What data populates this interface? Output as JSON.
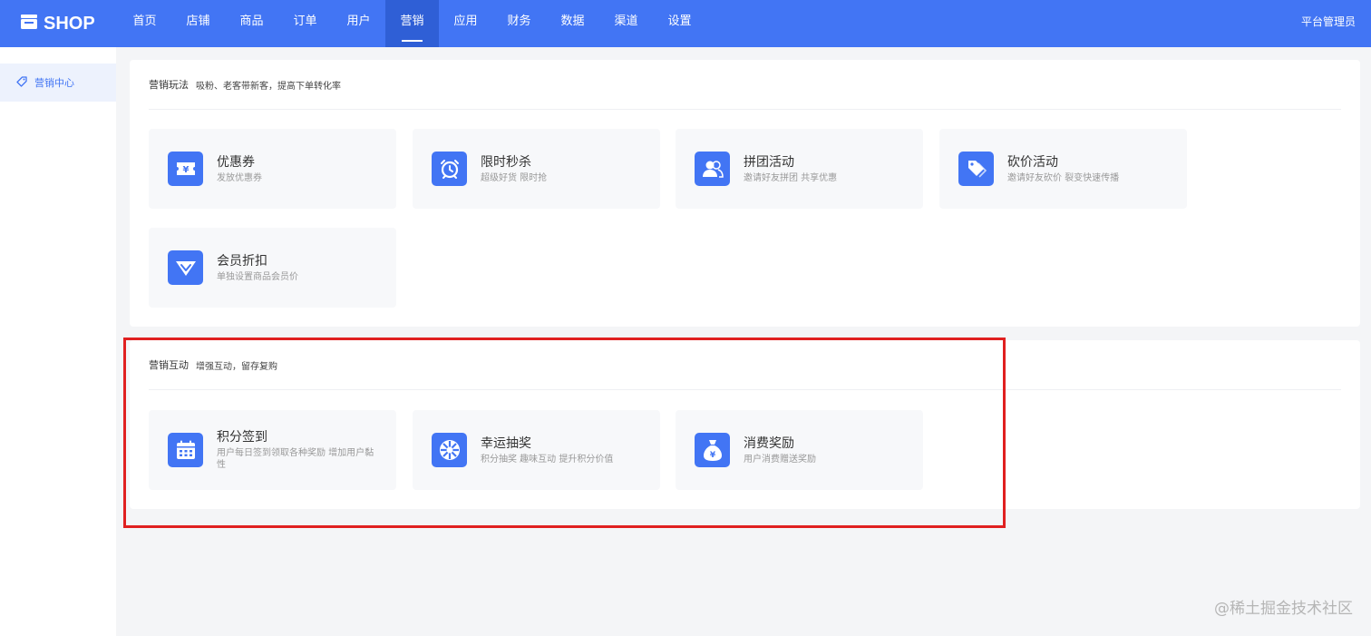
{
  "header": {
    "logo_text": "SHOP",
    "nav": [
      {
        "label": "首页",
        "active": false
      },
      {
        "label": "店铺",
        "active": false
      },
      {
        "label": "商品",
        "active": false
      },
      {
        "label": "订单",
        "active": false
      },
      {
        "label": "用户",
        "active": false
      },
      {
        "label": "营销",
        "active": true
      },
      {
        "label": "应用",
        "active": false
      },
      {
        "label": "财务",
        "active": false
      },
      {
        "label": "数据",
        "active": false
      },
      {
        "label": "渠道",
        "active": false
      },
      {
        "label": "设置",
        "active": false
      }
    ],
    "user_label": "平台管理员"
  },
  "sidebar": {
    "items": [
      {
        "label": "营销中心",
        "icon": "tag-icon",
        "active": true
      }
    ]
  },
  "sections": [
    {
      "title": "营销玩法",
      "subtitle": "吸粉、老客带新客，提高下单转化率",
      "cards": [
        {
          "title": "优惠券",
          "desc": "发放优惠券",
          "icon": "coupon-icon"
        },
        {
          "title": "限时秒杀",
          "desc": "超级好货 限时抢",
          "icon": "alarm-clock-icon"
        },
        {
          "title": "拼团活动",
          "desc": "邀请好友拼团 共享优惠",
          "icon": "group-users-icon"
        },
        {
          "title": "砍价活动",
          "desc": "邀请好友砍价 裂变快速传播",
          "icon": "price-tag-icon"
        },
        {
          "title": "会员折扣",
          "desc": "单独设置商品会员价",
          "icon": "diamond-icon"
        }
      ]
    },
    {
      "title": "营销互动",
      "subtitle": "增强互动，留存复购",
      "cards": [
        {
          "title": "积分签到",
          "desc": "用户每日签到领取各种奖励 增加用户黏性",
          "icon": "calendar-icon"
        },
        {
          "title": "幸运抽奖",
          "desc": "积分抽奖 趣味互动 提升积分价值",
          "icon": "lottery-wheel-icon"
        },
        {
          "title": "消费奖励",
          "desc": "用户消费赠送奖励",
          "icon": "money-bag-icon"
        }
      ]
    }
  ],
  "watermark": "@稀土掘金技术社区",
  "colors": {
    "primary": "#4275f4",
    "highlight_border": "#e02020",
    "background": "#f4f5f7"
  }
}
